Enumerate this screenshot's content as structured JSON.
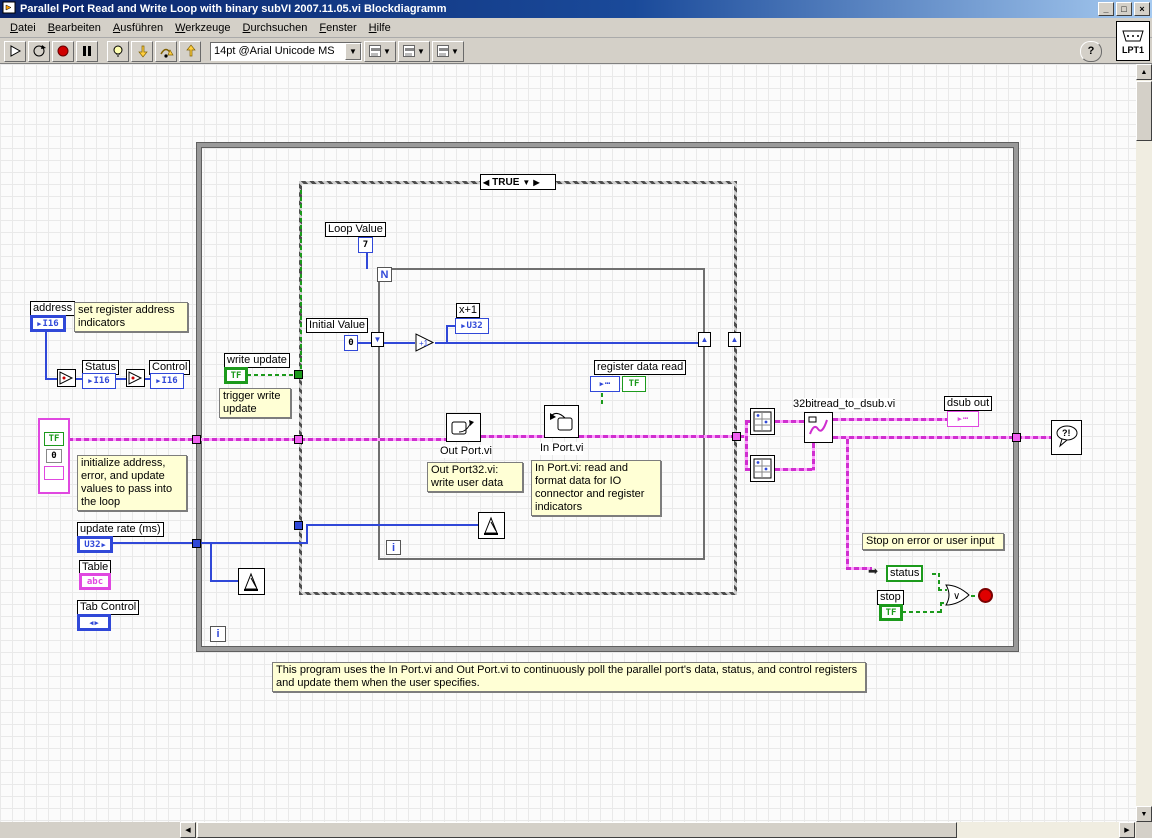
{
  "window": {
    "title": "Parallel Port Read and Write Loop with binary subVI 2007.11.05.vi Blockdiagramm",
    "controls": {
      "minimize": "_",
      "maximize": "□",
      "close": "×"
    }
  },
  "menu": {
    "items": [
      "Datei",
      "Bearbeiten",
      "Ausführen",
      "Werkzeuge",
      "Durchsuchen",
      "Fenster",
      "Hilfe"
    ]
  },
  "toolbar": {
    "font": "14pt @Arial Unicode MS",
    "help": "?",
    "vi_icon_label": "LPT1"
  },
  "glyphs": {
    "left": "◀",
    "right": "▶",
    "up": "▲",
    "down": "▼",
    "or": "∨",
    "bubble": "?!",
    "dots": "⋯",
    "unbundle": "➡"
  },
  "types": {
    "i16": "I16",
    "u32": "U32",
    "tf": "TF",
    "abc": "abc"
  },
  "diagram": {
    "case_selector": "TRUE",
    "loop_value": {
      "label": "Loop Value",
      "value": "7"
    },
    "initial_value": {
      "label": "Initial Value",
      "value": "0"
    },
    "n": "N",
    "i": "i",
    "x_plus_1": "x+1",
    "address": {
      "label": "address"
    },
    "status": {
      "label": "Status"
    },
    "control": {
      "label": "Control"
    },
    "write_update": {
      "label": "write update"
    },
    "error_cluster_value": "0",
    "update_rate": {
      "label": "update rate (ms)"
    },
    "table": {
      "label": "Table"
    },
    "tab_control": {
      "label": "Tab Control"
    },
    "out_port": {
      "label": "Out Port.vi"
    },
    "in_port": {
      "label": "In Port.vi"
    },
    "register_data_read": {
      "label": "register data read"
    },
    "dsub_vi": {
      "label": "32bitread_to_dsub.vi"
    },
    "dsub_out": {
      "label": "dsub out"
    },
    "status_indicator": {
      "label": "status"
    },
    "stop": {
      "label": "stop"
    },
    "comments": {
      "set_register": "set register address indicators",
      "trigger_write": "trigger write update",
      "initialize": "initialize address, error, and update values to pass into the loop",
      "out_port": "Out Port32.vi: write user data",
      "in_port": "In Port.vi: read and format data for IO connector and register indicators",
      "stop_on_error": "Stop on error or user input",
      "program": "This program uses the In Port.vi and Out Port.vi to continuously poll the parallel port's data, status, and control registers and update them when the user specifies."
    }
  }
}
